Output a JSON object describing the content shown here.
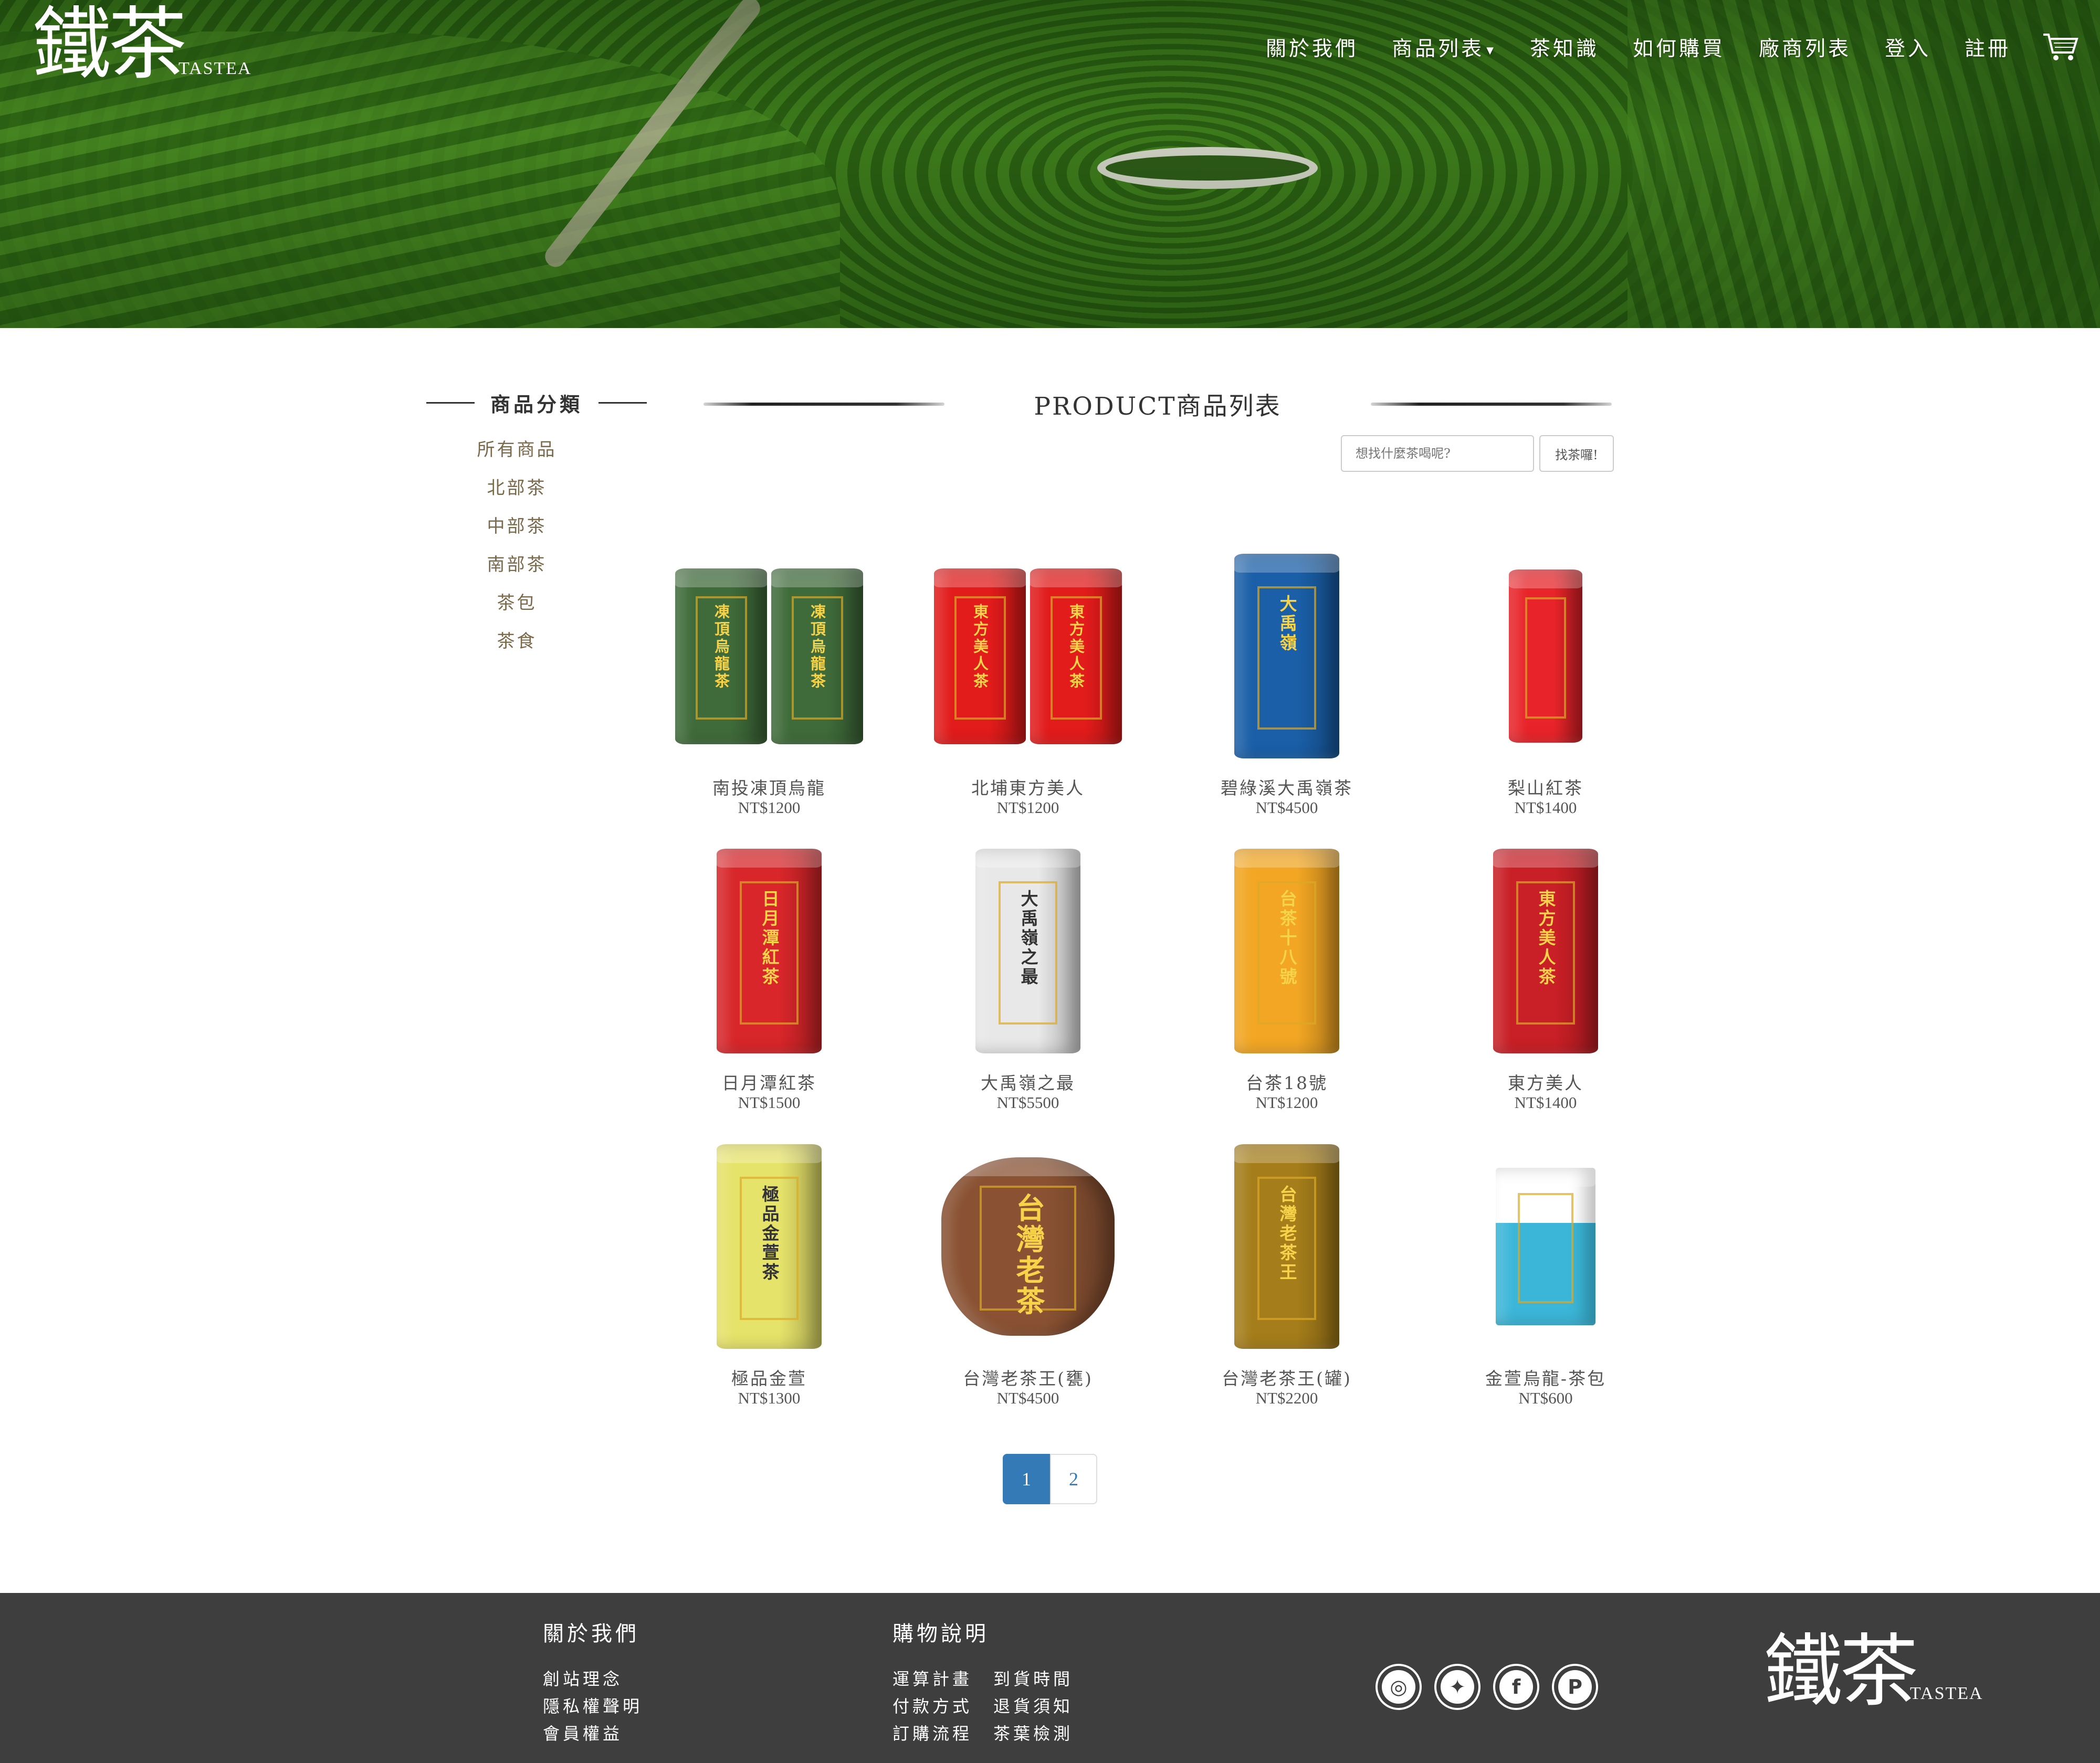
{
  "brand": {
    "logo_mark": "鐵茶",
    "logo_word": "TASTEA"
  },
  "nav": {
    "items": [
      {
        "label": "關於我們"
      },
      {
        "label": "商品列表",
        "has_caret": true
      },
      {
        "label": "茶知識"
      },
      {
        "label": "如何購買"
      },
      {
        "label": "廠商列表"
      },
      {
        "label": "登入"
      },
      {
        "label": "註冊"
      }
    ],
    "cart_icon": "shopping-cart-icon"
  },
  "sidebar": {
    "title": "商品分類",
    "categories": [
      {
        "label": "所有商品"
      },
      {
        "label": "北部茶"
      },
      {
        "label": "中部茶"
      },
      {
        "label": "南部茶"
      },
      {
        "label": "茶包"
      },
      {
        "label": "茶食"
      }
    ]
  },
  "main": {
    "title": "PRODUCT商品列表",
    "search": {
      "placeholder": "想找什麼茶喝呢?",
      "button_label": "找茶囉!"
    }
  },
  "products": [
    {
      "name": "南投凍頂烏龍",
      "price": "NT$1200",
      "color": "#3f6b3a",
      "label": "凍頂烏龍茶"
    },
    {
      "name": "北埔東方美人",
      "price": "NT$1200",
      "color": "#e21b1b",
      "label": "東方美人茶"
    },
    {
      "name": "碧綠溪大禹嶺茶",
      "price": "NT$4500",
      "color": "#1a5fa8",
      "label": "大禹嶺"
    },
    {
      "name": "梨山紅茶",
      "price": "NT$1400",
      "color": "#e8242a",
      "label": ""
    },
    {
      "name": "日月潭紅茶",
      "price": "NT$1500",
      "color": "#d8262a",
      "label": "日月潭紅茶"
    },
    {
      "name": "大禹嶺之最",
      "price": "NT$5500",
      "color": "#e8e8e8",
      "label": "大禹嶺之最"
    },
    {
      "name": "台茶18號",
      "price": "NT$1200",
      "color": "#f2a623",
      "label": "台茶十八號"
    },
    {
      "name": "東方美人",
      "price": "NT$1400",
      "color": "#c91f26",
      "label": "東方美人茶"
    },
    {
      "name": "極品金萱",
      "price": "NT$1300",
      "color": "#e6e36a",
      "label": "極品金萱茶"
    },
    {
      "name": "台灣老茶王(甕)",
      "price": "NT$4500",
      "color": "#8a5233",
      "label": "台灣老茶"
    },
    {
      "name": "台灣老茶王(罐)",
      "price": "NT$2200",
      "color": "#a57d1a",
      "label": "台灣老茶王"
    },
    {
      "name": "金萱烏龍-茶包",
      "price": "NT$600",
      "color": "#3bb6d8",
      "label": ""
    }
  ],
  "pagination": {
    "pages": [
      "1",
      "2"
    ],
    "current": "1"
  },
  "footer": {
    "about": {
      "title": "關於我們",
      "links": [
        "創站理念",
        "隱私權聲明",
        "會員權益"
      ]
    },
    "shopping": {
      "title": "購物說明",
      "rows": [
        [
          "運算計畫",
          "到貨時間"
        ],
        [
          "付款方式",
          "退貨須知"
        ],
        [
          "訂購流程",
          "茶葉檢測"
        ]
      ]
    },
    "social": [
      {
        "icon": "instagram-icon",
        "glyph": "◎"
      },
      {
        "icon": "twitter-icon",
        "glyph": "✦"
      },
      {
        "icon": "facebook-icon",
        "glyph": "f"
      },
      {
        "icon": "pinterest-icon",
        "glyph": "P"
      }
    ]
  }
}
